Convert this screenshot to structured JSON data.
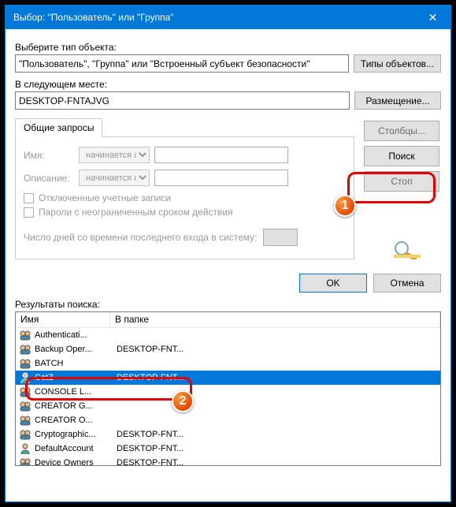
{
  "window": {
    "title": "Выбор: \"Пользователь\" или \"Группа\"",
    "close_icon": "✕"
  },
  "object_type": {
    "label": "Выберите тип объекта:",
    "value": "\"Пользователь\", \"Группа\" или \"Встроенный субъект безопасности\"",
    "button": "Типы объектов..."
  },
  "location": {
    "label": "В следующем месте:",
    "value": "DESKTOP-FNTAJVG",
    "button": "Размещение..."
  },
  "tabs": {
    "common": "Общие запросы"
  },
  "query": {
    "name_label": "Имя:",
    "desc_label": "Описание:",
    "starts_with": "начинается с",
    "chk_disabled": "Отключенные учетные записи",
    "chk_neverexp": "Пароли с неограниченным сроком действия",
    "days_label": "Число дней со времени последнего входа в систему:"
  },
  "side": {
    "columns": "Столбцы...",
    "search": "Поиск",
    "stop": "Стоп"
  },
  "actions": {
    "ok": "OK",
    "cancel": "Отмена"
  },
  "results": {
    "label": "Результаты поиска:",
    "col_name": "Имя",
    "col_folder": "В папке",
    "rows": [
      {
        "name": "Authenticati...",
        "folder": "",
        "type": "group"
      },
      {
        "name": "Backup Oper...",
        "folder": "DESKTOP-FNT...",
        "type": "group"
      },
      {
        "name": "BATCH",
        "folder": "",
        "type": "group"
      },
      {
        "name": "CatZ",
        "folder": "DESKTOP-FNT...",
        "type": "user",
        "selected": true
      },
      {
        "name": "CONSOLE L...",
        "folder": "",
        "type": "group"
      },
      {
        "name": "CREATOR G...",
        "folder": "",
        "type": "group"
      },
      {
        "name": "CREATOR O...",
        "folder": "",
        "type": "group"
      },
      {
        "name": "Cryptographic...",
        "folder": "DESKTOP-FNT...",
        "type": "group"
      },
      {
        "name": "DefaultAccount",
        "folder": "DESKTOP-FNT...",
        "type": "user"
      },
      {
        "name": "Device Owners",
        "folder": "DESKTOP-FNT...",
        "type": "group"
      }
    ]
  },
  "annotations": {
    "badge1": "1",
    "badge2": "2"
  }
}
